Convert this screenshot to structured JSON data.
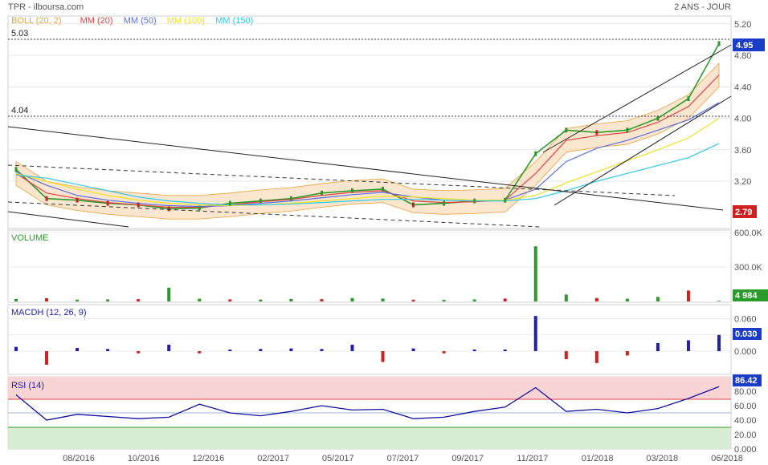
{
  "header": {
    "title": "TPR - ilboursa.com",
    "period": "2 ANS - JOUR"
  },
  "legend": [
    {
      "label": "BOLL (20, 2)",
      "color": "#e8a23c"
    },
    {
      "label": "MM (20)",
      "color": "#e04040"
    },
    {
      "label": "MM (50)",
      "color": "#5a6ee0"
    },
    {
      "label": "MM (100)",
      "color": "#f0e020"
    },
    {
      "label": "MM (150)",
      "color": "#30c8e8"
    }
  ],
  "panels": {
    "price": {
      "last_label": "4.95",
      "low_label": "2.79",
      "level_high": "5.03",
      "level_mid": "4.04"
    },
    "volume": {
      "title": "VOLUME",
      "last_label": "4 984"
    },
    "macd": {
      "title": "MACDH (12, 26, 9)",
      "last_label": "0.030"
    },
    "rsi": {
      "title": "RSI (14)",
      "last_label": "86.42"
    }
  },
  "colors": {
    "up": "#2a9a2a",
    "down": "#d02020",
    "macd": "#2020b0",
    "rsi_line": "#1010a0",
    "rsi_high_zone": "#f8d4d4",
    "rsi_low_zone": "#d8ecd4",
    "boll_fill": "#f6d2a8",
    "price_badge": "#1a3cc8",
    "low_badge": "#d02020",
    "volume_badge": "#2a9a2a",
    "grid": "#d8d8d8"
  },
  "chart_data": [
    {
      "type": "line",
      "title": "TPR",
      "x_ticks": [
        "08/2016",
        "10/2016",
        "12/2016",
        "02/2017",
        "05/2017",
        "07/2017",
        "09/2017",
        "11/2017",
        "01/2018",
        "03/2018",
        "06/2018"
      ],
      "y_ticks": [
        "5.20",
        "4.80",
        "4.40",
        "4.00",
        "3.60",
        "3.20"
      ],
      "ylim": [
        2.6,
        5.3
      ],
      "x": [
        "07/2016",
        "08/2016",
        "09/2016",
        "10/2016",
        "11/2016",
        "12/2016",
        "01/2017",
        "02/2017",
        "03/2017",
        "04/2017",
        "05/2017",
        "06/2017",
        "07/2017",
        "08/2017",
        "09/2017",
        "10/2017",
        "11/2017",
        "12/2017",
        "01/2018",
        "02/2018",
        "03/2018",
        "04/2018",
        "05/2018",
        "06/2018"
      ],
      "series": [
        {
          "name": "TPR",
          "values": [
            3.35,
            2.98,
            2.96,
            2.92,
            2.9,
            2.85,
            2.86,
            2.92,
            2.95,
            2.98,
            3.05,
            3.08,
            3.1,
            2.9,
            2.92,
            2.95,
            2.96,
            3.55,
            3.85,
            3.82,
            3.85,
            4.0,
            4.25,
            4.95
          ]
        },
        {
          "name": "MM (20)",
          "values": [
            3.3,
            3.05,
            2.98,
            2.93,
            2.9,
            2.87,
            2.87,
            2.9,
            2.94,
            2.97,
            3.02,
            3.06,
            3.08,
            2.95,
            2.93,
            2.94,
            2.96,
            3.3,
            3.72,
            3.78,
            3.82,
            3.95,
            4.15,
            4.55
          ]
        },
        {
          "name": "MM (50)",
          "values": [
            3.32,
            3.15,
            3.02,
            2.96,
            2.92,
            2.89,
            2.88,
            2.89,
            2.92,
            2.95,
            2.99,
            3.03,
            3.06,
            3.0,
            2.96,
            2.95,
            2.96,
            3.1,
            3.45,
            3.62,
            3.72,
            3.85,
            3.98,
            4.2
          ]
        },
        {
          "name": "MM (100)",
          "values": [
            3.3,
            3.2,
            3.1,
            3.02,
            2.96,
            2.92,
            2.9,
            2.89,
            2.9,
            2.92,
            2.95,
            2.98,
            3.01,
            3.0,
            2.98,
            2.96,
            2.96,
            3.02,
            3.18,
            3.32,
            3.46,
            3.6,
            3.75,
            4.0
          ]
        },
        {
          "name": "MM (150)",
          "values": [
            3.28,
            3.24,
            3.16,
            3.08,
            3.0,
            2.95,
            2.92,
            2.9,
            2.9,
            2.91,
            2.93,
            2.95,
            2.97,
            2.97,
            2.96,
            2.95,
            2.95,
            2.98,
            3.08,
            3.2,
            3.3,
            3.4,
            3.5,
            3.68
          ]
        }
      ]
    },
    {
      "type": "bar",
      "title": "VOLUME",
      "y_ticks": [
        "600.0K",
        "300.0K"
      ],
      "ylim": [
        0,
        600000
      ],
      "x": [
        "07/2016",
        "08/2016",
        "09/2016",
        "10/2016",
        "11/2016",
        "12/2016",
        "01/2017",
        "02/2017",
        "03/2017",
        "04/2017",
        "05/2017",
        "06/2017",
        "07/2017",
        "08/2017",
        "09/2017",
        "10/2017",
        "11/2017",
        "12/2017",
        "01/2018",
        "02/2018",
        "03/2018",
        "04/2018",
        "05/2018",
        "06/2018"
      ],
      "values": [
        22000,
        28000,
        15000,
        18000,
        20000,
        120000,
        24000,
        18000,
        16000,
        22000,
        20000,
        30000,
        25000,
        15000,
        14000,
        18000,
        25000,
        480000,
        60000,
        30000,
        24000,
        40000,
        95000,
        4984
      ]
    },
    {
      "type": "bar",
      "title": "MACDH (12, 26, 9)",
      "y_ticks": [
        "0.060",
        "0.030",
        "0.000"
      ],
      "ylim": [
        -0.04,
        0.08
      ],
      "x": [
        "07/2016",
        "08/2016",
        "09/2016",
        "10/2016",
        "11/2016",
        "12/2016",
        "01/2017",
        "02/2017",
        "03/2017",
        "04/2017",
        "05/2017",
        "06/2017",
        "07/2017",
        "08/2017",
        "09/2017",
        "10/2017",
        "11/2017",
        "12/2017",
        "01/2018",
        "02/2018",
        "03/2018",
        "04/2018",
        "05/2018",
        "06/2018"
      ],
      "values": [
        0.008,
        -0.025,
        0.006,
        0.004,
        -0.004,
        0.012,
        -0.004,
        0.003,
        0.004,
        0.005,
        0.004,
        0.012,
        -0.02,
        0.005,
        -0.004,
        0.003,
        0.003,
        0.065,
        -0.015,
        -0.022,
        -0.008,
        0.015,
        0.02,
        0.03
      ]
    },
    {
      "type": "line",
      "title": "RSI (14)",
      "y_ticks": [
        "80.00",
        "60.00",
        "40.00",
        "20.00",
        "0.000"
      ],
      "ylim": [
        0,
        100
      ],
      "x": [
        "07/2016",
        "08/2016",
        "09/2016",
        "10/2016",
        "11/2016",
        "12/2016",
        "01/2017",
        "02/2017",
        "03/2017",
        "04/2017",
        "05/2017",
        "06/2017",
        "07/2017",
        "08/2017",
        "09/2017",
        "10/2017",
        "11/2017",
        "12/2017",
        "01/2018",
        "02/2018",
        "03/2018",
        "04/2018",
        "05/2018",
        "06/2018"
      ],
      "values": [
        75,
        40,
        48,
        45,
        42,
        44,
        62,
        50,
        46,
        52,
        60,
        54,
        55,
        42,
        44,
        52,
        58,
        85,
        52,
        55,
        50,
        56,
        70,
        86.42
      ]
    }
  ]
}
